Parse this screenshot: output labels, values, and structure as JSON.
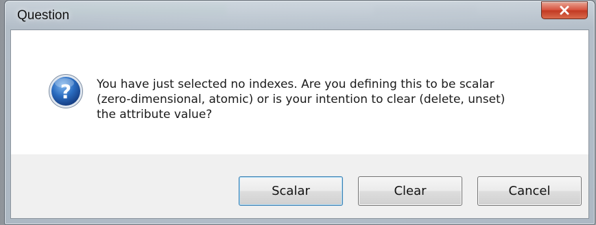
{
  "dialog": {
    "title": "Question",
    "message": "You have just selected no indexes.  Are you defining this to be scalar\n(zero-dimensional, atomic) or is your intention to clear (delete, unset)\nthe attribute value?",
    "icon": "question-icon",
    "close_icon": "close-icon"
  },
  "buttons": {
    "scalar": "Scalar",
    "clear": "Clear",
    "cancel": "Cancel"
  },
  "colors": {
    "close_button": "#c8432b",
    "icon_blue": "#1f5fa8",
    "default_button_border": "#3c7fb1"
  }
}
